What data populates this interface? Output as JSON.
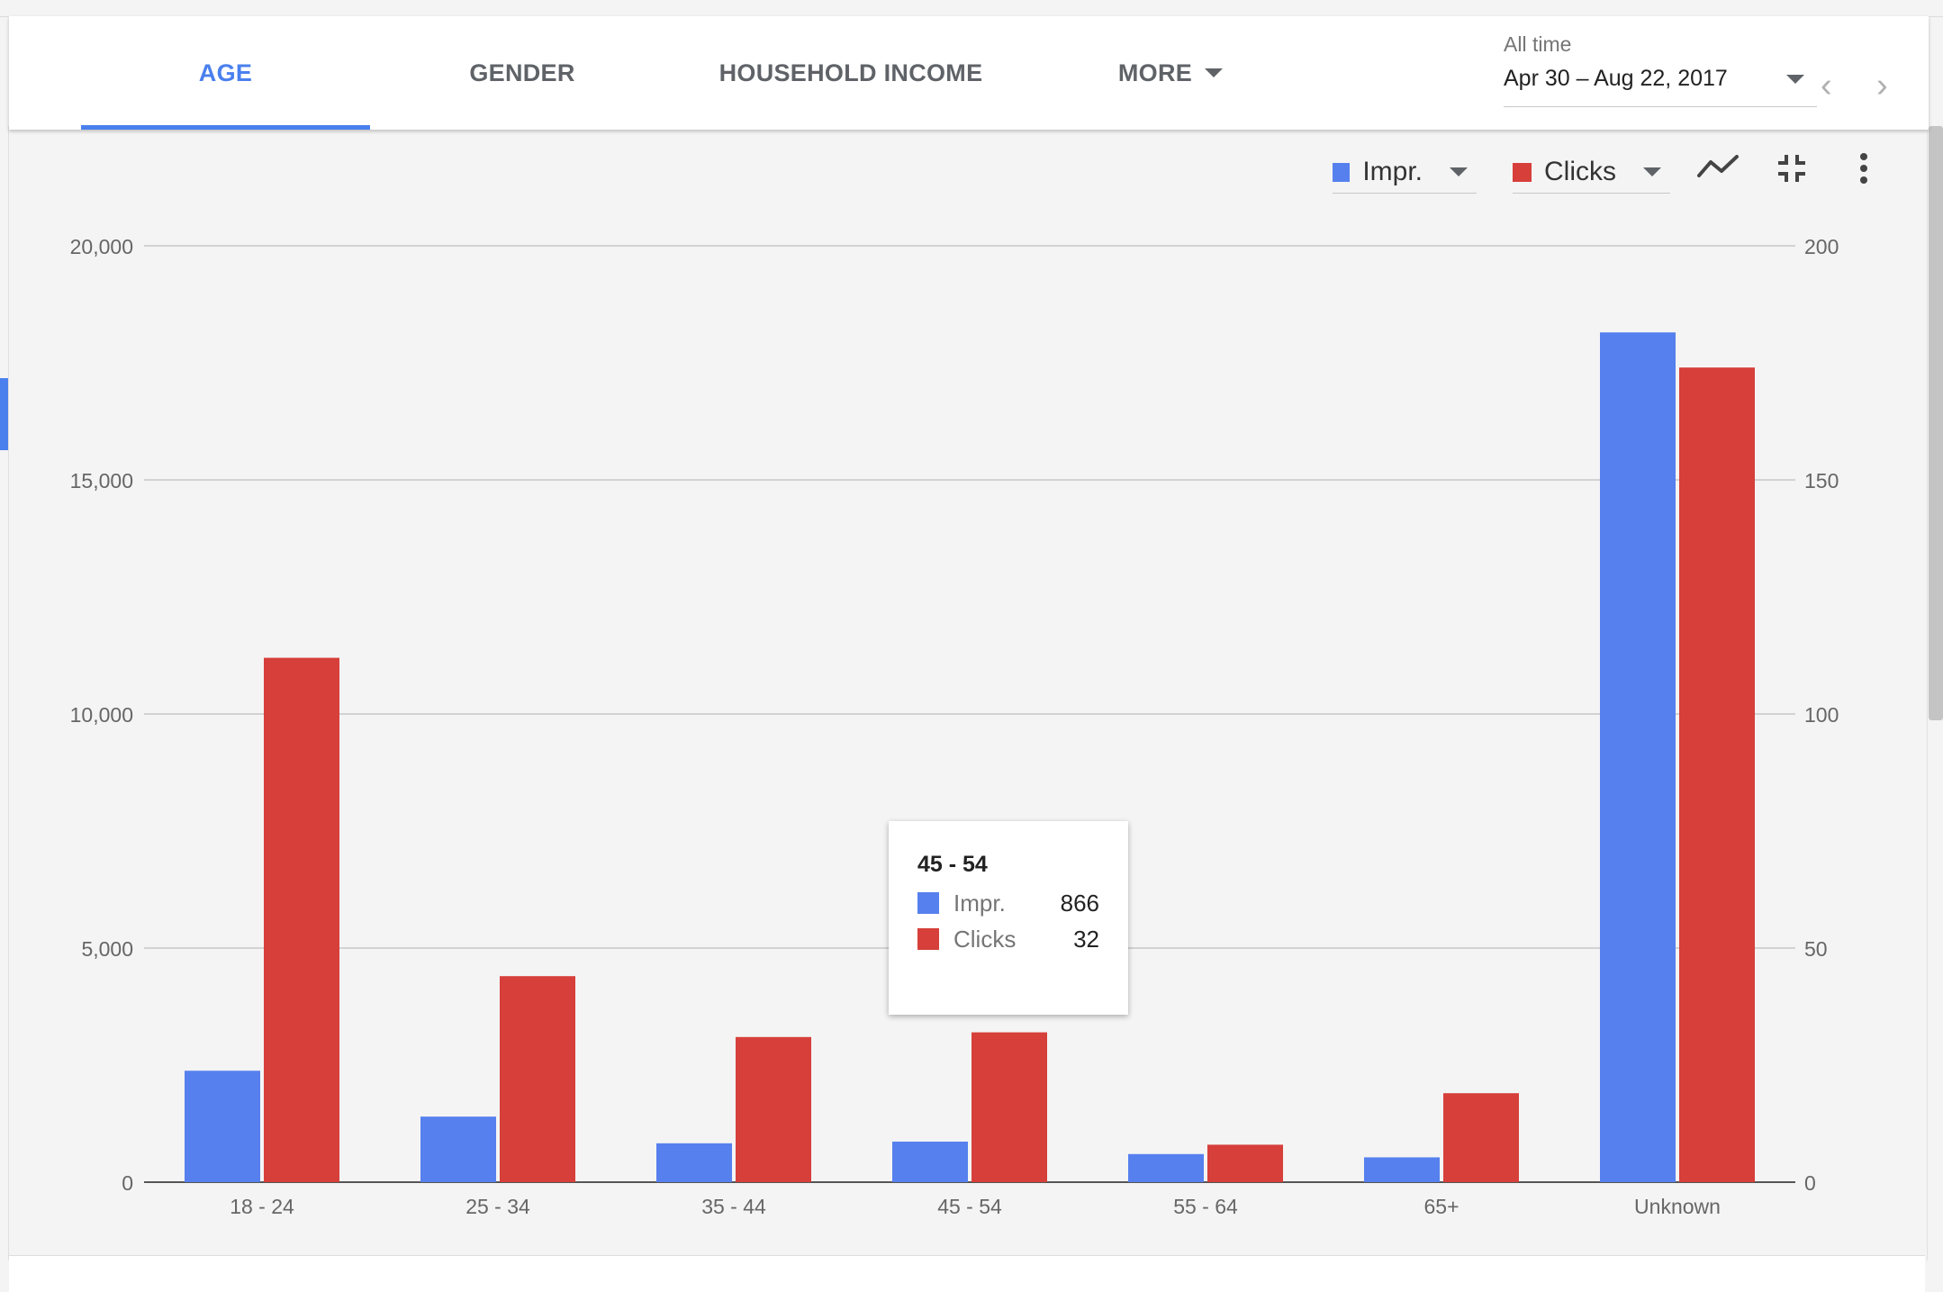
{
  "tabs": [
    {
      "label": "AGE",
      "active": true
    },
    {
      "label": "GENDER",
      "active": false
    },
    {
      "label": "HOUSEHOLD INCOME",
      "active": false
    },
    {
      "label": "MORE",
      "active": false
    }
  ],
  "date": {
    "label": "All time",
    "range": "Apr 30 – Aug 22, 2017"
  },
  "metrics": {
    "primary": {
      "label": "Impr.",
      "color": "#5680ee"
    },
    "secondary": {
      "label": "Clicks",
      "color": "#d63f3a"
    }
  },
  "icons": [
    "line-chart-icon",
    "collapse-icon",
    "more-vert-icon",
    "chevron-left-icon",
    "chevron-right-icon"
  ],
  "tooltip": {
    "category": "45 - 54",
    "rows": [
      {
        "label": "Impr.",
        "value": "866",
        "color": "#5680ee"
      },
      {
        "label": "Clicks",
        "value": "32",
        "color": "#d63f3a"
      }
    ]
  },
  "chart_data": {
    "type": "bar",
    "categories": [
      "18 - 24",
      "25 - 34",
      "35 - 44",
      "45 - 54",
      "55 - 64",
      "65+",
      "Unknown"
    ],
    "series": [
      {
        "name": "Impr.",
        "axis": "left",
        "color": "#5680ee",
        "values": [
          2380,
          1400,
          830,
          866,
          600,
          530,
          18150
        ]
      },
      {
        "name": "Clicks",
        "axis": "right",
        "color": "#d63f3a",
        "values": [
          112,
          44,
          31,
          32,
          8,
          19,
          174
        ]
      }
    ],
    "y_left": {
      "ylim": [
        0,
        20000
      ],
      "ticks": [
        "0",
        "5,000",
        "10,000",
        "15,000",
        "20,000"
      ],
      "tick_values": [
        0,
        5000,
        10000,
        15000,
        20000
      ]
    },
    "y_right": {
      "ylim": [
        0,
        200
      ],
      "ticks": [
        "0",
        "50",
        "100",
        "150",
        "200"
      ],
      "tick_values": [
        0,
        50,
        100,
        150,
        200
      ]
    },
    "grid": true,
    "legend": "top-right"
  }
}
